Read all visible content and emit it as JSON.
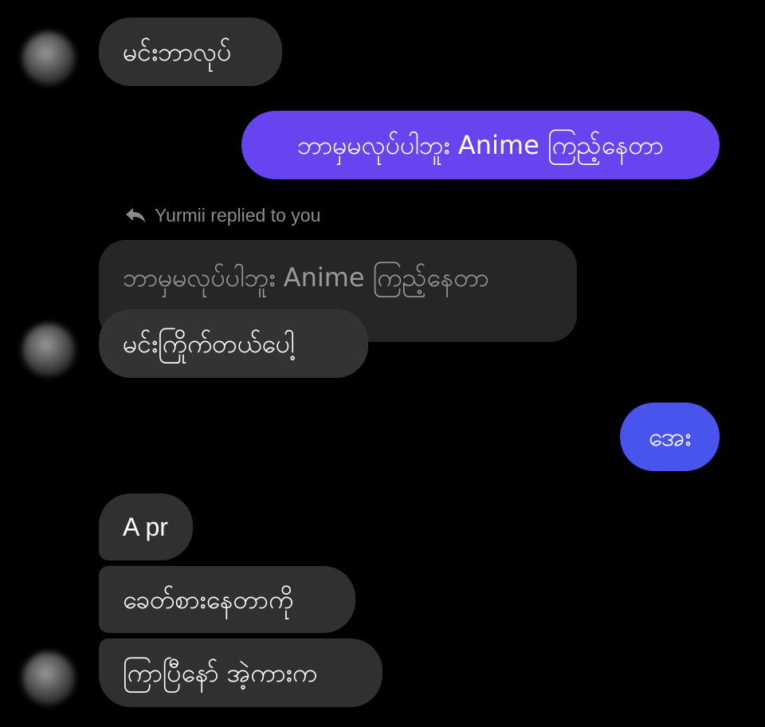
{
  "messages": {
    "m1": "မင်းဘာလုပ်",
    "m2": "ဘာမှမလုပ်ပါဘူး Anime ကြည့်နေတာ",
    "reply_label": "Yurmii replied to you",
    "quoted": "ဘာမှမလုပ်ပါဘူး Anime ကြည့်နေတာ",
    "m3": "မင်းကြိုက်တယ်ပေါ့",
    "m4": "အေး",
    "m5": "A pr",
    "m6": "ခေတ်စားနေတာကို",
    "m7": "ကြာပြီနော် အဲ့ကားက"
  },
  "colors": {
    "background": "#000000",
    "incoming_bubble": "#303030",
    "outgoing_bubble_purple": "#6744f0",
    "outgoing_bubble_blue": "#4855ec",
    "reply_text": "#8c8c8c"
  },
  "icons": {
    "reply": "reply-arrow-icon",
    "avatar": "blurred-profile-avatar"
  }
}
